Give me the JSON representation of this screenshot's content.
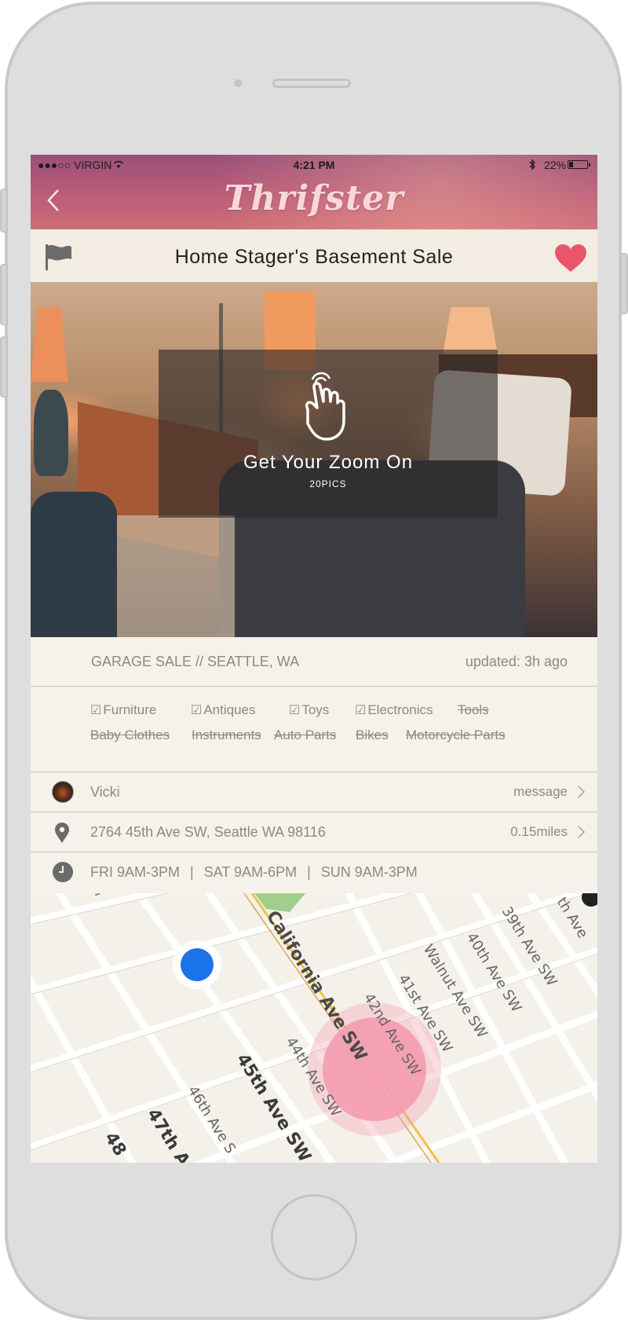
{
  "status_bar": {
    "carrier": "●●●○○ VIRGIN",
    "time": "4:21 PM",
    "battery": "22%",
    "battery_level": 0.22
  },
  "header": {
    "app_name": "Thrifster",
    "back_icon": "chevron-left-icon"
  },
  "listing": {
    "title": "Home Stager's Basement Sale",
    "flag_icon": "flag-icon",
    "favorite_icon": "heart-icon",
    "favorite_color": "#e9566a"
  },
  "photo": {
    "overlay_text": "Get Your Zoom On",
    "count": "20PICS"
  },
  "info": {
    "sale_type": "GARAGE SALE // SEATTLE, WA",
    "updated": "updated: 3h ago"
  },
  "categories": [
    {
      "label": "Furniture",
      "checked": true
    },
    {
      "label": "Antiques",
      "checked": true
    },
    {
      "label": "Toys",
      "checked": true
    },
    {
      "label": "Electronics",
      "checked": true
    },
    {
      "label": "Tools",
      "checked": false
    },
    {
      "label": "Baby Clothes",
      "checked": false
    },
    {
      "label": "Instruments",
      "checked": false
    },
    {
      "label": "Auto Parts",
      "checked": false
    },
    {
      "label": "Bikes",
      "checked": false
    },
    {
      "label": "Motorcycle Parts",
      "checked": false
    }
  ],
  "seller": {
    "name": "Vicki",
    "action": "message"
  },
  "location": {
    "address": "2764 45th Ave SW, Seattle WA 98116",
    "distance": "0.15miles"
  },
  "hours": {
    "fri": "FRI 9AM-3PM",
    "sat": "SAT 9AM-6PM",
    "sun": "SUN 9AM-3PM",
    "separator": "|"
  },
  "map": {
    "streets": [
      "California Ave SW",
      "45th Ave SW",
      "44th Ave SW",
      "42nd Ave SW",
      "41st Ave SW",
      "Walnut Ave SW",
      "40th Ave SW",
      "39th Ave SW",
      "46th Ave S",
      "47th A",
      "48",
      "SW",
      "th Ave"
    ],
    "user_dot_color": "#1a73e8",
    "sale_marker_color": "#f49bb0"
  }
}
